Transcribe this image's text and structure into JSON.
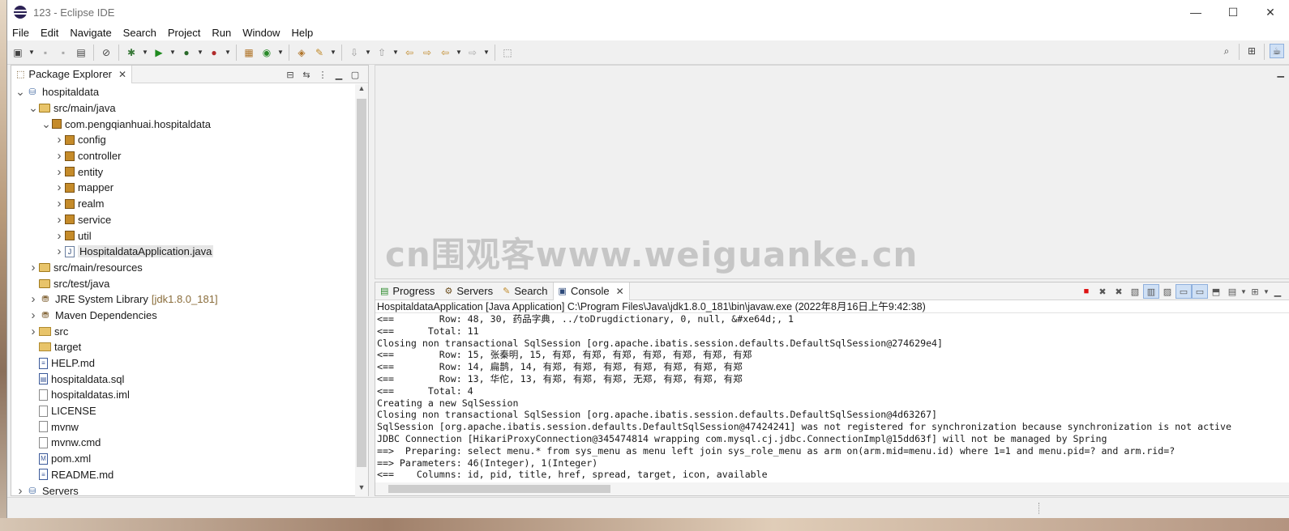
{
  "window": {
    "title": "123 - Eclipse IDE",
    "controls": {
      "minimize": "—",
      "maximize": "☐",
      "close": "✕"
    }
  },
  "menu": [
    "File",
    "Edit",
    "Navigate",
    "Search",
    "Project",
    "Run",
    "Window",
    "Help"
  ],
  "explorer": {
    "tab_label": "Package Explorer",
    "tree": [
      {
        "label": "hospitaldata",
        "indent": 0,
        "arrow": "v",
        "icon": "project-icon"
      },
      {
        "label": "src/main/java",
        "indent": 1,
        "arrow": "v",
        "icon": "package-folder-icon"
      },
      {
        "label": "com.pengqianhuai.hospitaldata",
        "indent": 2,
        "arrow": "v",
        "icon": "package-icon"
      },
      {
        "label": "config",
        "indent": 3,
        "arrow": ">",
        "icon": "package-icon"
      },
      {
        "label": "controller",
        "indent": 3,
        "arrow": ">",
        "icon": "package-icon"
      },
      {
        "label": "entity",
        "indent": 3,
        "arrow": ">",
        "icon": "package-icon"
      },
      {
        "label": "mapper",
        "indent": 3,
        "arrow": ">",
        "icon": "package-icon"
      },
      {
        "label": "realm",
        "indent": 3,
        "arrow": ">",
        "icon": "package-icon"
      },
      {
        "label": "service",
        "indent": 3,
        "arrow": ">",
        "icon": "package-icon"
      },
      {
        "label": "util",
        "indent": 3,
        "arrow": ">",
        "icon": "package-icon"
      },
      {
        "label": "HospitaldataApplication.java",
        "indent": 3,
        "arrow": ">",
        "icon": "java-file-icon",
        "selected": true
      },
      {
        "label": "src/main/resources",
        "indent": 1,
        "arrow": ">",
        "icon": "package-folder-icon"
      },
      {
        "label": "src/test/java",
        "indent": 1,
        "arrow": "",
        "icon": "package-folder-icon"
      },
      {
        "label": "JRE System Library",
        "suffix": "[jdk1.8.0_181]",
        "indent": 1,
        "arrow": ">",
        "icon": "library-icon"
      },
      {
        "label": "Maven Dependencies",
        "indent": 1,
        "arrow": ">",
        "icon": "library-icon"
      },
      {
        "label": "src",
        "indent": 1,
        "arrow": ">",
        "icon": "folder-icon"
      },
      {
        "label": "target",
        "indent": 1,
        "arrow": "",
        "icon": "folder-icon"
      },
      {
        "label": "HELP.md",
        "indent": 1,
        "arrow": "",
        "icon": "markdown-file-icon"
      },
      {
        "label": "hospitaldata.sql",
        "indent": 1,
        "arrow": "",
        "icon": "sql-file-icon"
      },
      {
        "label": "hospitaldatas.iml",
        "indent": 1,
        "arrow": "",
        "icon": "file-icon"
      },
      {
        "label": "LICENSE",
        "indent": 1,
        "arrow": "",
        "icon": "file-icon"
      },
      {
        "label": "mvnw",
        "indent": 1,
        "arrow": "",
        "icon": "file-icon"
      },
      {
        "label": "mvnw.cmd",
        "indent": 1,
        "arrow": "",
        "icon": "file-icon"
      },
      {
        "label": "pom.xml",
        "indent": 1,
        "arrow": "",
        "icon": "xml-file-icon"
      },
      {
        "label": "README.md",
        "indent": 1,
        "arrow": "",
        "icon": "markdown-file-icon"
      },
      {
        "label": "Servers",
        "indent": 0,
        "arrow": ">",
        "icon": "servers-project-icon"
      }
    ]
  },
  "watermark": "cn围观客www.weiguanke.cn",
  "console": {
    "tabs": [
      {
        "label": "Progress",
        "icon": "progress-icon"
      },
      {
        "label": "Servers",
        "icon": "servers-icon"
      },
      {
        "label": "Search",
        "icon": "search-icon"
      },
      {
        "label": "Console",
        "icon": "console-icon",
        "active": true
      }
    ],
    "launch_label": "HospitaldataApplication [Java Application] C:\\Program Files\\Java\\jdk1.8.0_181\\bin\\javaw.exe  (2022年8月16日上午9:42:38)",
    "lines": [
      "<==        Row: 48, 30, 药品字典, ../toDrugdictionary, 0, null, &#xe64d;, 1",
      "<==      Total: 11",
      "Closing non transactional SqlSession [org.apache.ibatis.session.defaults.DefaultSqlSession@274629e4]",
      "<==        Row: 15, 张秦明, 15, 有郑, 有郑, 有郑, 有郑, 有郑, 有郑, 有郑",
      "<==        Row: 14, 扁鹊, 14, 有郑, 有郑, 有郑, 有郑, 有郑, 有郑, 有郑",
      "<==        Row: 13, 华佗, 13, 有郑, 有郑, 有郑, 无郑, 有郑, 有郑, 有郑",
      "<==      Total: 4",
      "Creating a new SqlSession",
      "Closing non transactional SqlSession [org.apache.ibatis.session.defaults.DefaultSqlSession@4d63267]",
      "SqlSession [org.apache.ibatis.session.defaults.DefaultSqlSession@47424241] was not registered for synchronization because synchronization is not active",
      "JDBC Connection [HikariProxyConnection@345474814 wrapping com.mysql.cj.jdbc.ConnectionImpl@15dd63f] will not be managed by Spring",
      "==>  Preparing: select menu.* from sys_menu as menu left join sys_role_menu as arm on(arm.mid=menu.id) where 1=1 and menu.pid=? and arm.rid=?",
      "==> Parameters: 46(Integer), 1(Integer)",
      "<==    Columns: id, pid, title, href, spread, target, icon, available"
    ]
  }
}
